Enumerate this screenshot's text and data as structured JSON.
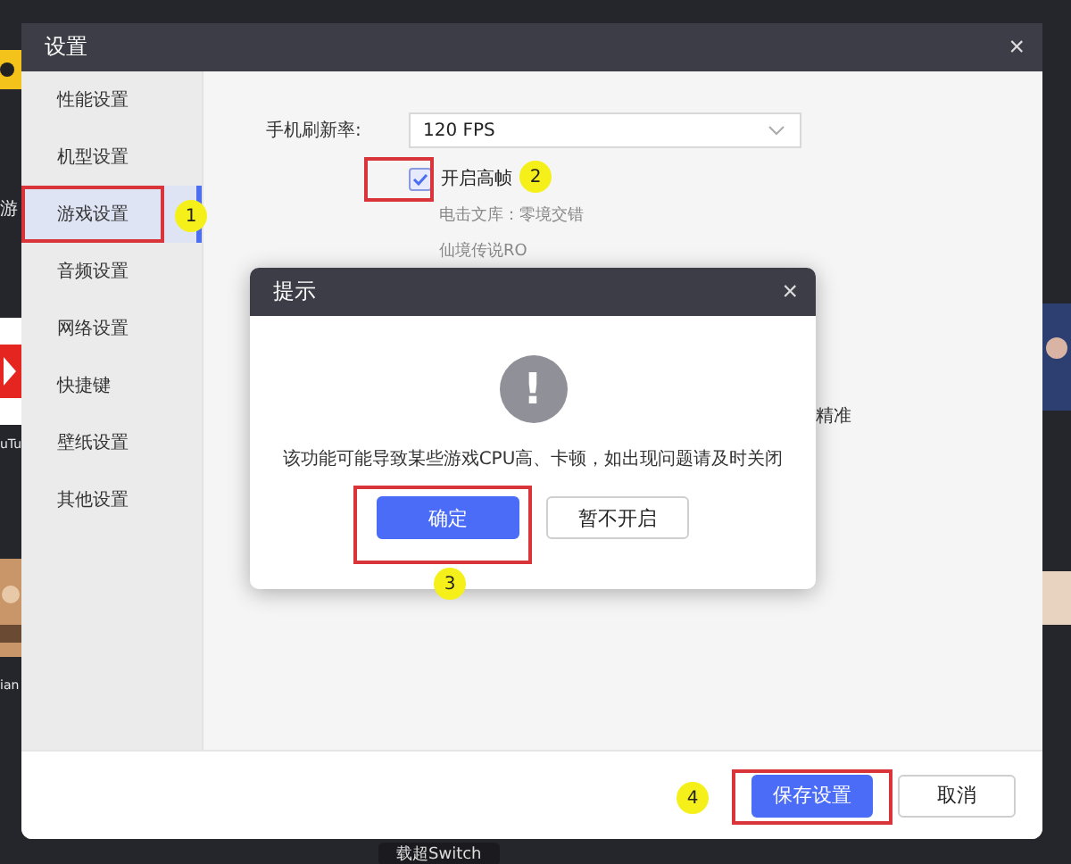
{
  "background": {
    "side_labels": [
      "游",
      "uTu",
      "ian"
    ],
    "bottom_label": "载超Switch"
  },
  "window": {
    "title": "设置",
    "close": "×"
  },
  "sidebar": {
    "items": [
      {
        "label": "性能设置",
        "selected": false
      },
      {
        "label": "机型设置",
        "selected": false
      },
      {
        "label": "游戏设置",
        "selected": true
      },
      {
        "label": "音频设置",
        "selected": false
      },
      {
        "label": "网络设置",
        "selected": false
      },
      {
        "label": "快捷键",
        "selected": false
      },
      {
        "label": "壁纸设置",
        "selected": false
      },
      {
        "label": "其他设置",
        "selected": false
      }
    ]
  },
  "content": {
    "refresh_label": "手机刷新率:",
    "refresh_value": "120 FPS",
    "high_fps": {
      "label": "开启高帧",
      "checked": true
    },
    "games": [
      "电击文库：零境交错",
      "仙境传说RO"
    ],
    "partial_text": "精准"
  },
  "dialog": {
    "title": "提示",
    "close": "×",
    "icon": "!",
    "message": "该功能可能导致某些游戏CPU高、卡顿，如出现问题请及时关闭",
    "buttons": [
      {
        "label": "确定",
        "kind": "primary"
      },
      {
        "label": "暂不开启",
        "kind": "secondary"
      }
    ]
  },
  "footer": {
    "buttons": [
      {
        "label": "保存设置",
        "kind": "primary"
      },
      {
        "label": "取消",
        "kind": "secondary"
      }
    ]
  },
  "annotations": [
    {
      "number": "1"
    },
    {
      "number": "2"
    },
    {
      "number": "3"
    },
    {
      "number": "4"
    }
  ]
}
